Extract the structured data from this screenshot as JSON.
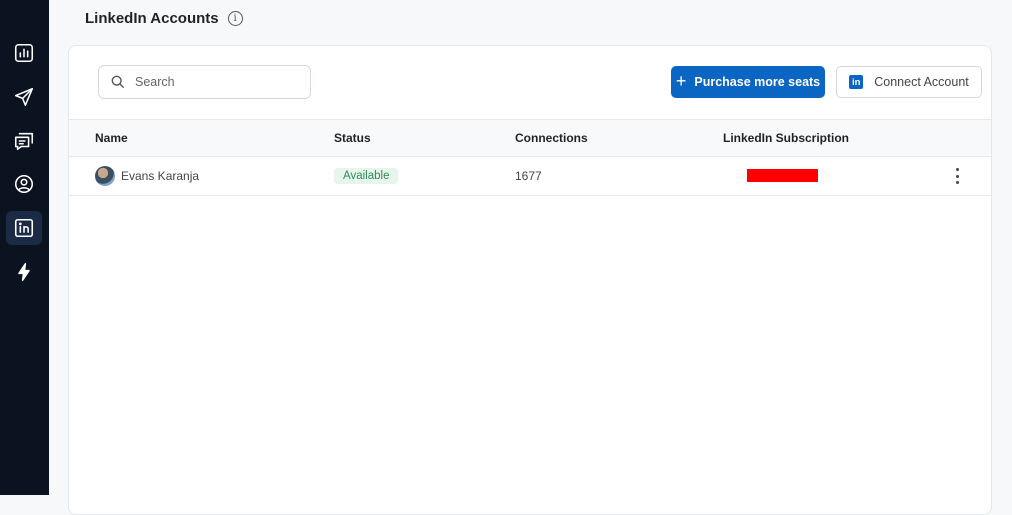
{
  "header": {
    "title": "LinkedIn Accounts"
  },
  "sidebar": {
    "items": [
      {
        "name": "analytics",
        "icon": "bar-chart-icon"
      },
      {
        "name": "campaigns",
        "icon": "send-icon"
      },
      {
        "name": "inbox",
        "icon": "messages-icon"
      },
      {
        "name": "contacts",
        "icon": "user-circle-icon"
      },
      {
        "name": "linkedin-accounts",
        "icon": "linkedin-icon",
        "active": true
      },
      {
        "name": "automations",
        "icon": "lightning-icon"
      }
    ]
  },
  "search": {
    "placeholder": "Search",
    "value": ""
  },
  "buttons": {
    "purchase": "Purchase more seats",
    "connect": "Connect Account",
    "linkedin_logo": "in"
  },
  "table": {
    "columns": [
      "Name",
      "Status",
      "Connections",
      "LinkedIn Subscription"
    ],
    "rows": [
      {
        "name": "Evans Karanja",
        "status": "Available",
        "connections": "1677"
      }
    ]
  },
  "colors": {
    "sidebar": "#0b1320",
    "primary": "#0a66c2",
    "status_available": "#2e8b57",
    "redaction": "#ff0000"
  }
}
